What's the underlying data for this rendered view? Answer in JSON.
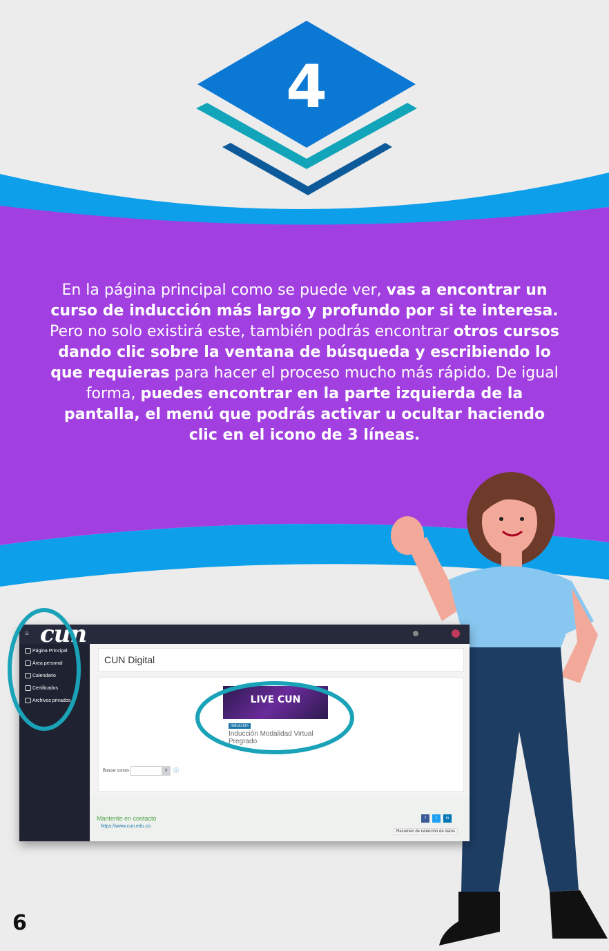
{
  "step_number": "4",
  "body_text": {
    "p1": "En la página principal como se puede ver, ",
    "b1": "vas a encontrar  un curso de inducción más largo y profundo por si te interesa.",
    "p2": " Pero no solo existirá este, también podrás encontrar ",
    "b2": "otros cursos  dando  clic sobre la ventana de búsqueda  y escribiendo lo que requieras",
    "p3": " para hacer el proceso mucho más rápido. De igual forma, ",
    "b3": "puedes  encontrar en la parte izquierda de la pantalla, el menú que podrás activar u ocultar haciendo clic en el icono de 3 líneas."
  },
  "screenshot": {
    "logo": "cun",
    "sidebar": [
      "Página Principal",
      "Área personal",
      "Calendario",
      "Certificados",
      "Archivos privados"
    ],
    "title": "CUN Digital",
    "course_banner": "LIVE CUN",
    "course_tag": "Inducción",
    "course_name": "Inducción Modalidad Virtual Pregrado",
    "search_label": "Buscar cursos",
    "search_button": "Ir",
    "contact_title": "Mantente en contacto",
    "contact_url": "https://www.cun.edu.co",
    "social": [
      "f",
      "t",
      "in"
    ],
    "retention": "Resumen de retención de datos"
  },
  "page_number": "6",
  "colors": {
    "purple": "#a23fe0",
    "blue_band": "#0e9fea",
    "diamond_blue": "#0b78d4",
    "teal": "#12a4b8",
    "dark_blue": "#0d5a9a"
  }
}
